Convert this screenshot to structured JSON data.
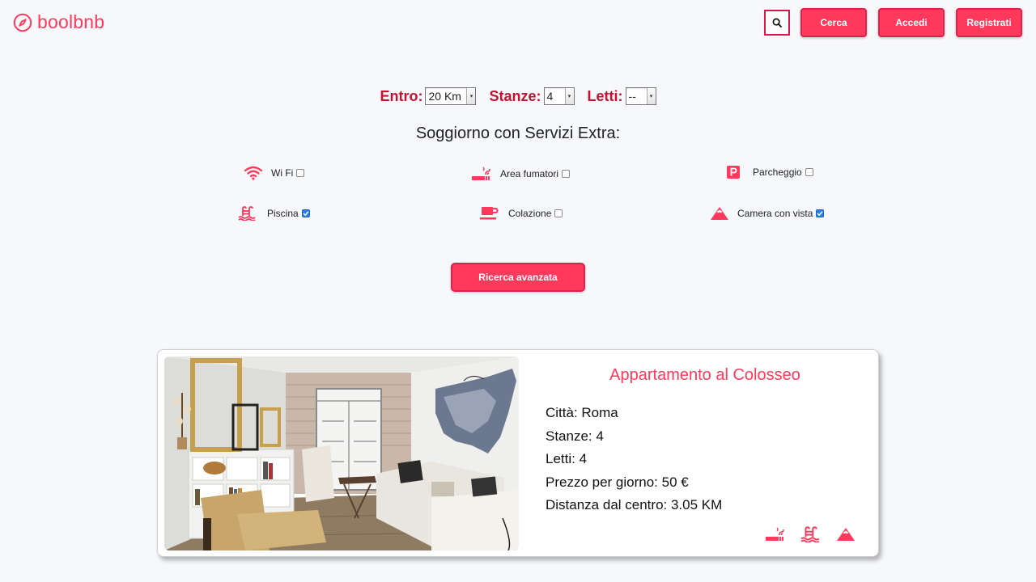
{
  "brand": {
    "name": "boolbnb",
    "accent": "#ff385c"
  },
  "header": {
    "search_icon": "search-icon",
    "buttons": {
      "cerca": "Cerca",
      "accedi": "Accedi",
      "registrati": "Registrati"
    }
  },
  "filters": {
    "distance": {
      "label": "Entro:",
      "value": "20 Km"
    },
    "rooms": {
      "label": "Stanze:",
      "value": "4"
    },
    "beds": {
      "label": "Letti:",
      "value": "--"
    }
  },
  "services_title": "Soggiorno con Servizi Extra:",
  "services": [
    {
      "label": "Wi Fi",
      "icon": "wifi-icon",
      "checked": false
    },
    {
      "label": "Area fumatori",
      "icon": "smoking-icon",
      "checked": false
    },
    {
      "label": "Parcheggio",
      "icon": "parking-icon",
      "checked": false
    },
    {
      "label": "Piscina",
      "icon": "pool-icon",
      "checked": true
    },
    {
      "label": "Colazione",
      "icon": "coffee-icon",
      "checked": false
    },
    {
      "label": "Camera con vista",
      "icon": "mountain-icon",
      "checked": true
    }
  ],
  "advanced_search_label": "Ricerca avanzata",
  "listing": {
    "title": "Appartamento al Colosseo",
    "city": "Città: Roma",
    "rooms": "Stanze: 4",
    "beds": "Letti: 4",
    "price": "Prezzo per giorno: 50 €",
    "distance": "Distanza dal centro: 3.05 KM",
    "icons": [
      "smoking-icon",
      "pool-icon",
      "mountain-icon"
    ]
  }
}
